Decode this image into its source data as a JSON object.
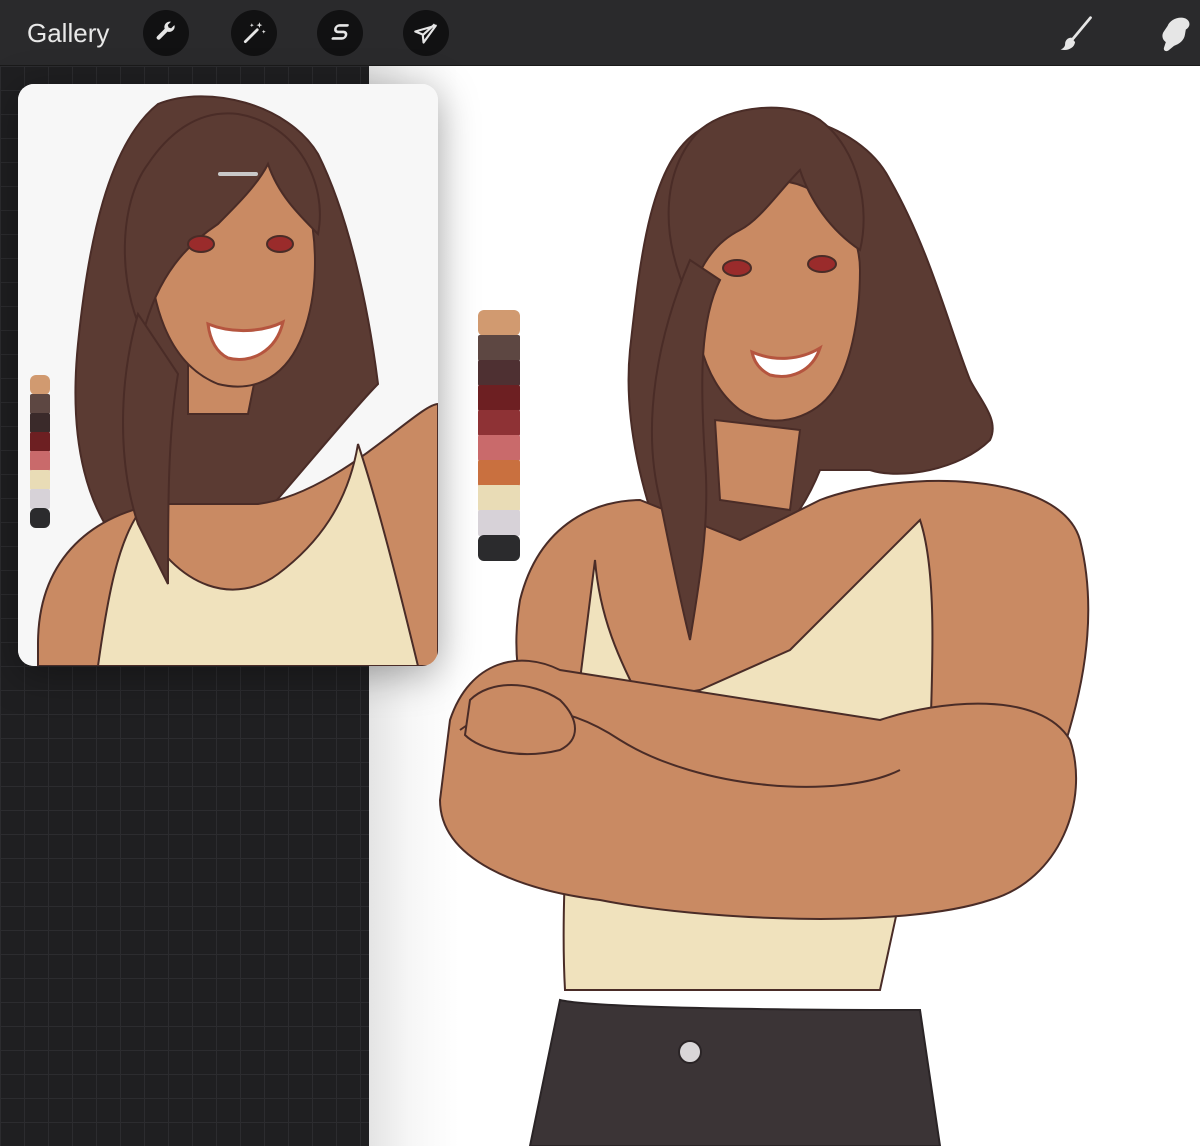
{
  "toolbar": {
    "gallery_label": "Gallery",
    "left_tools": [
      {
        "name": "actions",
        "icon": "wrench-icon"
      },
      {
        "name": "adjustments",
        "icon": "magic-wand-icon"
      },
      {
        "name": "selection",
        "icon": "selection-s-icon"
      },
      {
        "name": "transform",
        "icon": "arrow-cursor-icon"
      }
    ],
    "right_tools": [
      {
        "name": "brush",
        "icon": "brush-icon"
      },
      {
        "name": "smudge",
        "icon": "smudge-icon"
      }
    ]
  },
  "colors": {
    "skin": "#c98a63",
    "skin_shadow": "#b9774f",
    "hair": "#5b3b33",
    "hair_dark": "#4a2d27",
    "tank_top": "#f0e2bd",
    "pants": "#3b3436",
    "lineart": "#4a2c27",
    "lips": "#b5553f",
    "eyes": "#9a2b2b"
  },
  "palette_swatches": [
    "#d19a70",
    "#5d4742",
    "#4e3032",
    "#6d1f22",
    "#8e3235",
    "#c96a6b",
    "#c9703f",
    "#e9dcb6",
    "#d7d2d8",
    "#2b2b2d"
  ],
  "reference_palette_swatches": [
    "#d19a70",
    "#5d4742",
    "#3a2a2a",
    "#6d1f22",
    "#c96a6b",
    "#e9dcb6",
    "#d7d2d8",
    "#2b2b2d"
  ]
}
